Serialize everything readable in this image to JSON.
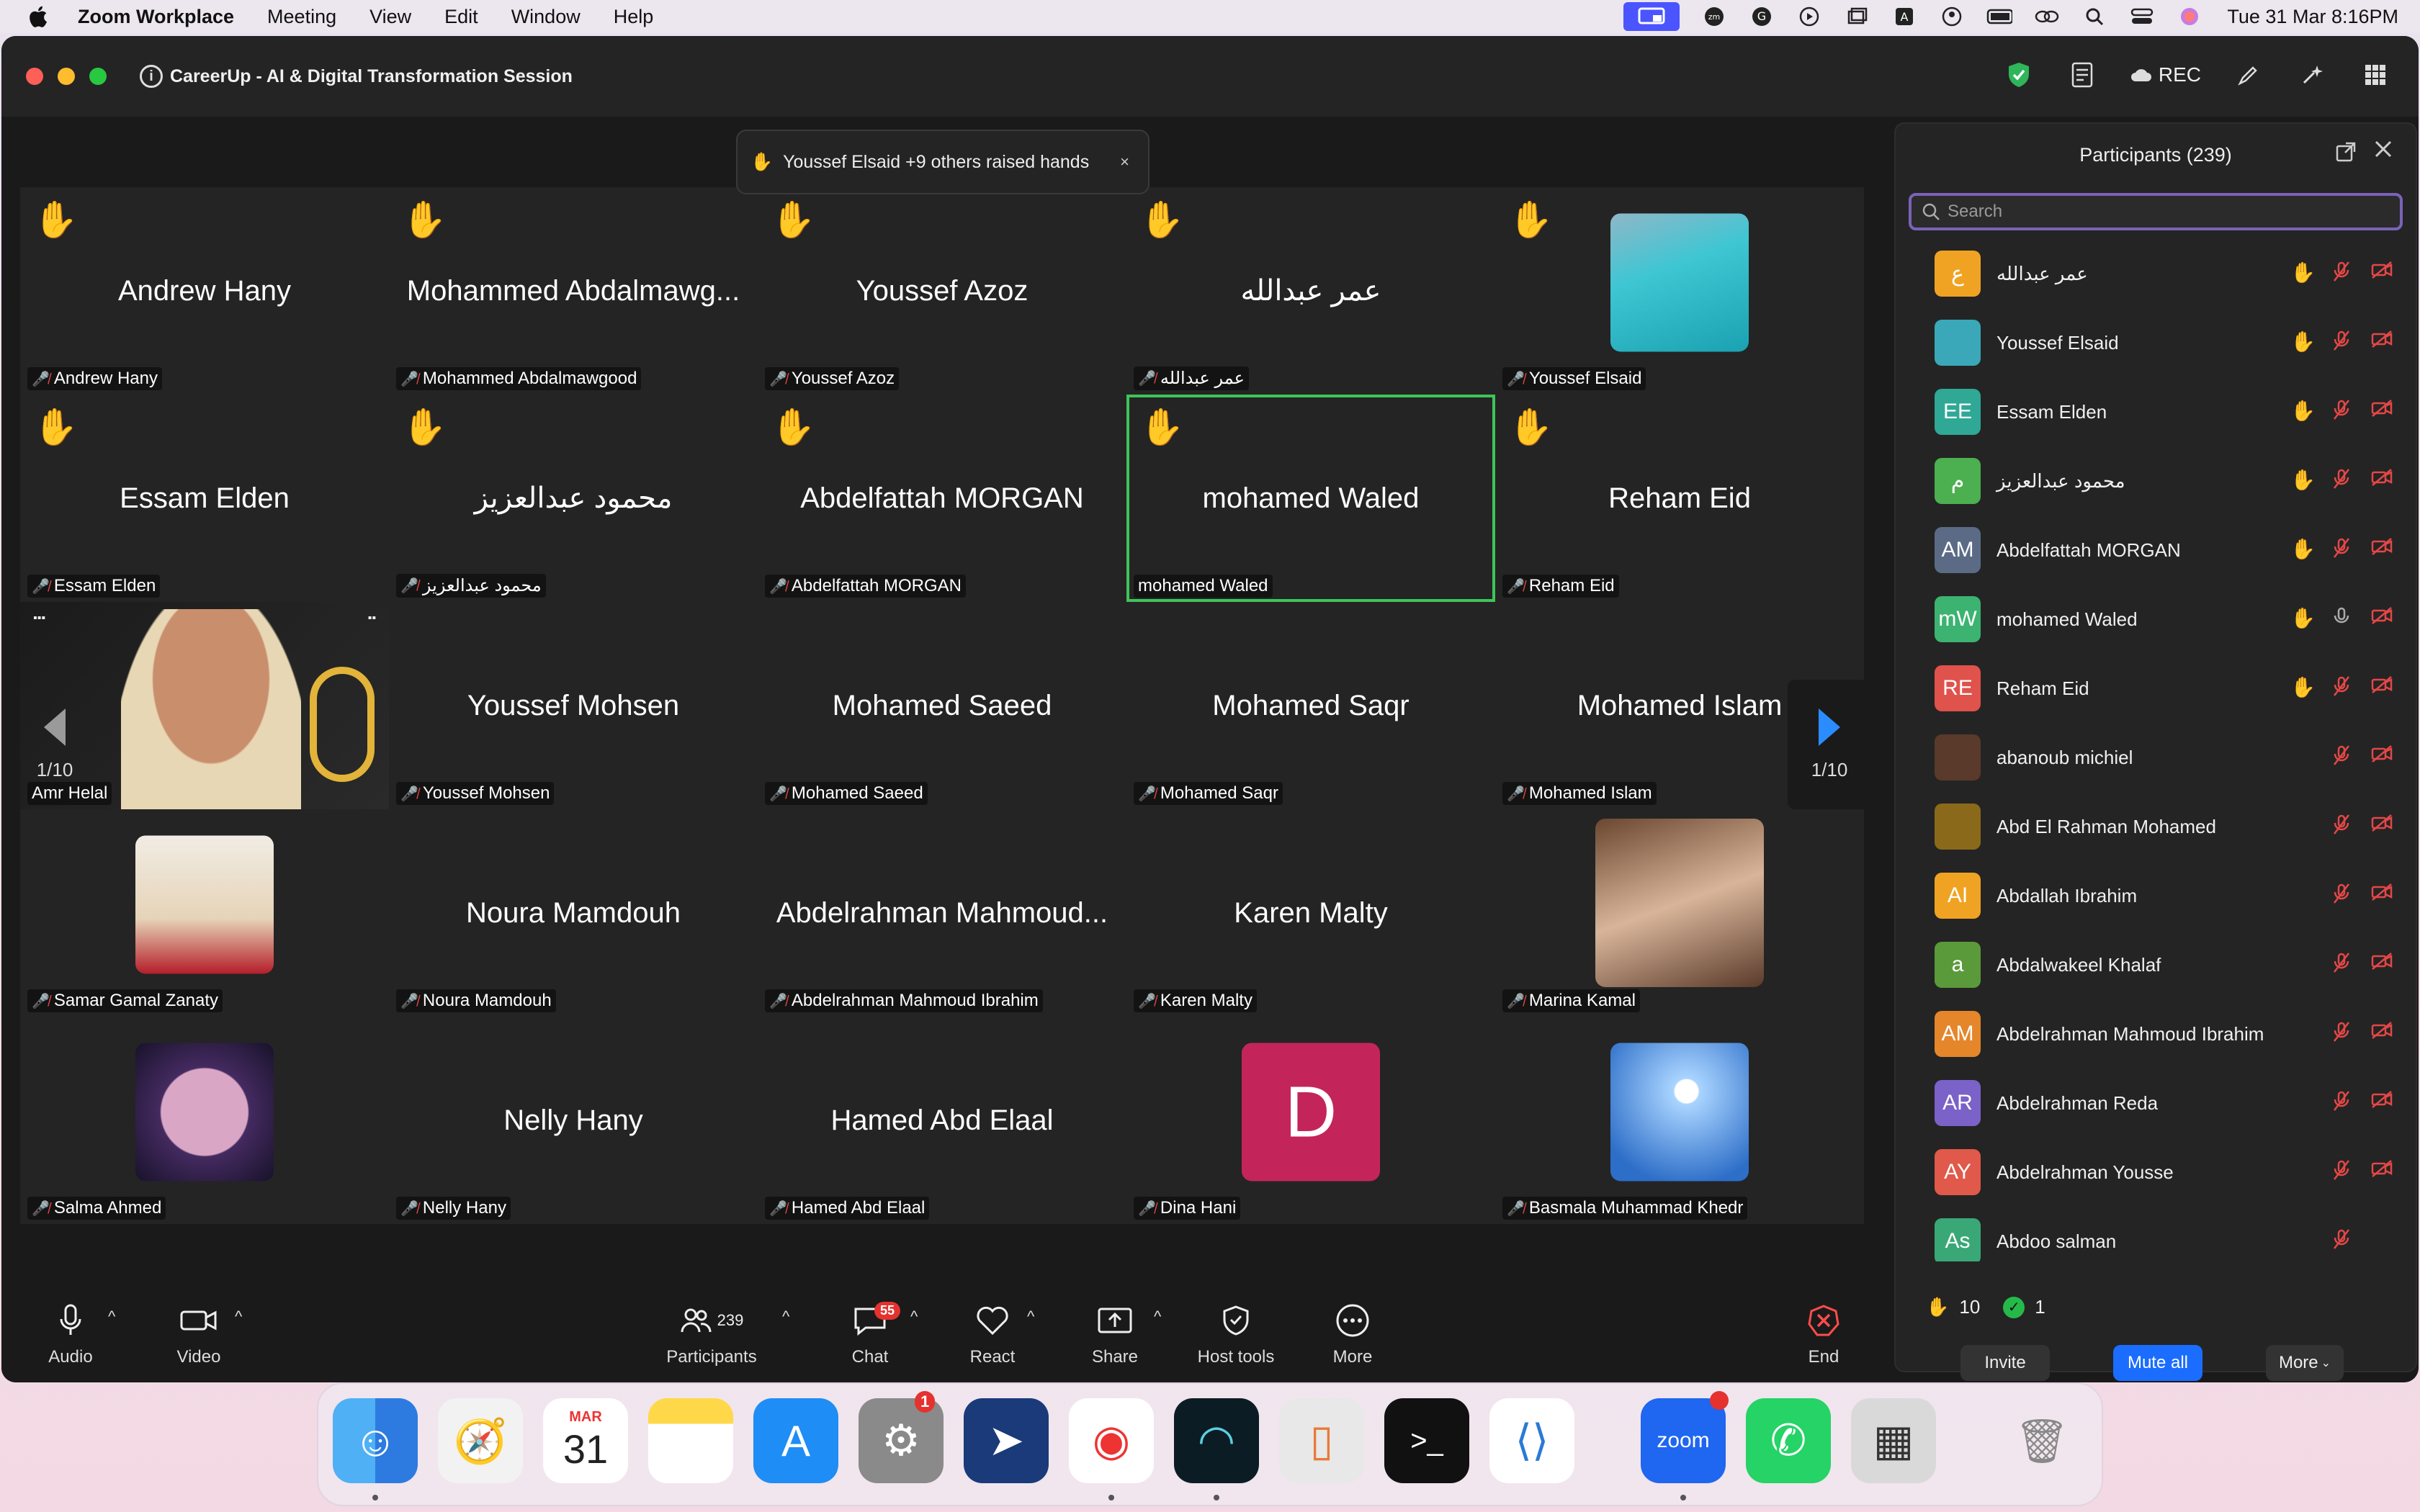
{
  "menubar": {
    "app": "Zoom Workplace",
    "items": [
      "Meeting",
      "View",
      "Edit",
      "Window",
      "Help"
    ],
    "clock": "Tue 31 Mar  8:16PM"
  },
  "window": {
    "title": "CareerUp - AI & Digital Transformation Session",
    "rec_label": "REC"
  },
  "toast": {
    "text": "Youssef Elsaid +9 others raised hands",
    "close": "×"
  },
  "gallery": {
    "tiles": [
      {
        "big": "Andrew Hany",
        "label": "Andrew Hany",
        "hand": true
      },
      {
        "big": "Mohammed Abdalmawg...",
        "label": "Mohammed Abdalmawgood",
        "hand": true
      },
      {
        "big": "Youssef Azoz",
        "label": "Youssef Azoz",
        "hand": true
      },
      {
        "big": "عمر عبدالله",
        "label": "عمر عبدالله",
        "hand": true
      },
      {
        "big": "",
        "label": "Youssef Elsaid",
        "hand": true
      },
      {
        "big": "Essam Elden",
        "label": "Essam Elden",
        "hand": true
      },
      {
        "big": "محمود عبدالعزيز",
        "label": "محمود عبدالعزيز",
        "hand": true
      },
      {
        "big": "Abdelfattah MORGAN",
        "label": "Abdelfattah MORGAN",
        "hand": true
      },
      {
        "big": "mohamed Waled",
        "label": "mohamed Waled",
        "hand": true
      },
      {
        "big": "Reham Eid",
        "label": "Reham Eid",
        "hand": true
      },
      {
        "big": "",
        "label": "Amr Helal",
        "hand": false
      },
      {
        "big": "Youssef Mohsen",
        "label": "Youssef Mohsen",
        "hand": false
      },
      {
        "big": "Mohamed Saeed",
        "label": "Mohamed Saeed",
        "hand": false
      },
      {
        "big": "Mohamed Saqr",
        "label": "Mohamed Saqr",
        "hand": false
      },
      {
        "big": "Mohamed Islam",
        "label": "Mohamed Islam",
        "hand": false
      },
      {
        "big": "",
        "label": "Samar Gamal Zanaty",
        "hand": false
      },
      {
        "big": "Noura Mamdouh",
        "label": "Noura Mamdouh",
        "hand": false
      },
      {
        "big": "Abdelrahman Mahmoud...",
        "label": "Abdelrahman Mahmoud Ibrahim",
        "hand": false
      },
      {
        "big": "Karen Malty",
        "label": "Karen Malty",
        "hand": false
      },
      {
        "big": "",
        "label": "Marina Kamal",
        "hand": false
      },
      {
        "big": "",
        "label": "Salma Ahmed",
        "hand": false
      },
      {
        "big": "Nelly Hany",
        "label": "Nelly Hany",
        "hand": false
      },
      {
        "big": "Hamed Abd Elaal",
        "label": "Hamed Abd Elaal",
        "hand": false
      },
      {
        "big": "D",
        "label": "Dina Hani",
        "hand": false
      },
      {
        "big": "",
        "label": "Basmala Muhammad Khedr",
        "hand": false
      }
    ],
    "page_left": "1/10",
    "page_right": "1/10"
  },
  "panel": {
    "title": "Participants (239)",
    "search_placeholder": "Search",
    "participants": [
      {
        "initials": "ع",
        "name": "عمر عبدالله",
        "color": "#f0a323",
        "hand": true
      },
      {
        "initials": "",
        "name": "Youssef Elsaid",
        "color": "#3aa8b8",
        "hand": true
      },
      {
        "initials": "EE",
        "name": "Essam Elden",
        "color": "#2fa896",
        "hand": true
      },
      {
        "initials": "م",
        "name": "محمود عبدالعزيز",
        "color": "#4caf50",
        "hand": true
      },
      {
        "initials": "AM",
        "name": "Abdelfattah MORGAN",
        "color": "#5b6b86",
        "hand": true
      },
      {
        "initials": "mW",
        "name": "mohamed Waled",
        "color": "#3cb371",
        "hand": true
      },
      {
        "initials": "RE",
        "name": "Reham Eid",
        "color": "#e0524c",
        "hand": true
      },
      {
        "initials": "",
        "name": "abanoub michiel",
        "color": "#5a3a2a",
        "hand": false
      },
      {
        "initials": "",
        "name": "Abd El Rahman Mohamed",
        "color": "#8a6a1a",
        "hand": false
      },
      {
        "initials": "AI",
        "name": "Abdallah Ibrahim",
        "color": "#f0a323",
        "hand": false
      },
      {
        "initials": "a",
        "name": "Abdalwakeel Khalaf",
        "color": "#5a9a3a",
        "hand": false
      },
      {
        "initials": "AM",
        "name": "Abdelrahman Mahmoud Ibrahim",
        "color": "#e5862a",
        "hand": false
      },
      {
        "initials": "AR",
        "name": "Abdelrahman Reda",
        "color": "#7a62c8",
        "hand": false
      },
      {
        "initials": "AY",
        "name": "Abdelrahman Yousse",
        "color": "#e0594a",
        "hand": false
      },
      {
        "initials": "As",
        "name": "Abdoo salman",
        "color": "#3aa876",
        "hand": false
      }
    ],
    "raised_count": "10",
    "check_count": "1",
    "invite": "Invite",
    "mute_all": "Mute all",
    "more": "More"
  },
  "toolbar": {
    "audio": "Audio",
    "video": "Video",
    "participants": "Participants",
    "participants_count": "239",
    "chat": "Chat",
    "chat_badge": "55",
    "react": "React",
    "share": "Share",
    "host_tools": "Host tools",
    "more": "More",
    "end": "End"
  },
  "dock": {
    "calendar_month": "MAR",
    "calendar_day": "31",
    "settings_badge": "1"
  },
  "colors": {
    "accent": "#2a8cff",
    "active_speaker": "#3ec45a",
    "mic_muted": "#e54747"
  }
}
